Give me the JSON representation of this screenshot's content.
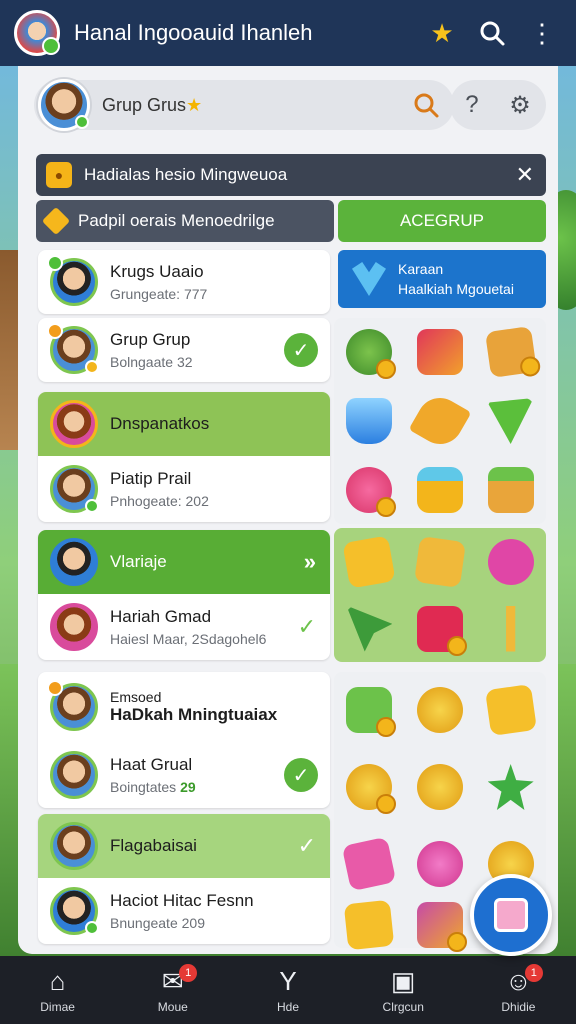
{
  "app": {
    "title": "Hanal Ingooauid Ihanleh"
  },
  "topbar": {
    "icons": [
      "star-icon",
      "search-icon",
      "more-icon"
    ]
  },
  "search": {
    "label": "Grup Grus"
  },
  "banners": {
    "first": {
      "text": "Hadialas hesio Mingweuoa"
    },
    "second": {
      "text": "Padpil oerais Menoedrilge"
    },
    "add_button": "ACEGRUP"
  },
  "promo": {
    "line1": "Karaan",
    "line2": "Haalkiah Mgouetai"
  },
  "list": [
    {
      "title": "Krugs Uaaio",
      "sub": "Grungeate: 777",
      "state": "plain"
    },
    {
      "title": "Grup Grup",
      "sub": "Bolngaate 32",
      "state": "checked"
    },
    {
      "title": "Dnspanatkos",
      "sub": "",
      "state": "highlight"
    },
    {
      "title": "Piatip Prail",
      "sub": "Pnhogeate: 202",
      "state": "plain"
    },
    {
      "title": "Vlariaje",
      "sub": "",
      "state": "active"
    },
    {
      "title": "Hariah Gmad",
      "sub": "Haiesl Maar, 2Sdagohel6",
      "state": "check-plain"
    },
    {
      "title": "Emsoed",
      "title2": "HaDkah Mningtuaiax",
      "sub": "",
      "state": "plain"
    },
    {
      "title": "Haat Grual",
      "sub": "Boingtates",
      "sub_value": "29",
      "state": "checked"
    },
    {
      "title": "Flagabaisai",
      "sub": "",
      "state": "highlight-light"
    },
    {
      "title": "Haciot Hitac Fesnn",
      "sub": "Bnungeate 209",
      "state": "plain"
    }
  ],
  "nav": [
    {
      "label": "Dimae",
      "icon": "home-icon"
    },
    {
      "label": "Moue",
      "icon": "messages-icon",
      "badge": "1"
    },
    {
      "label": "Hde",
      "icon": "tools-icon"
    },
    {
      "label": "Clrgcun",
      "icon": "game-icon"
    },
    {
      "label": "Dhidie",
      "icon": "profile-icon",
      "badge": "1"
    }
  ],
  "colors": {
    "topbar": "#1f3558",
    "accent_green": "#5bb33b",
    "accent_blue": "#1c74cc",
    "nav": "#1d2027"
  }
}
